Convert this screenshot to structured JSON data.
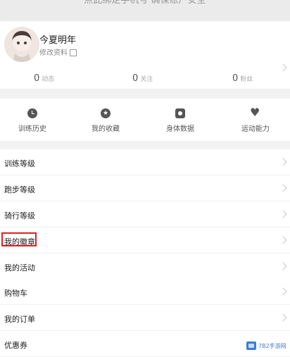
{
  "top_banner": {
    "text": "点此绑定手机号   确保账户安全"
  },
  "profile": {
    "name": "今夏明年",
    "edit_label": "修改资料",
    "stats": [
      {
        "value": "0",
        "label": "动态"
      },
      {
        "value": "0",
        "label": "关注"
      },
      {
        "value": "0",
        "label": "粉丝"
      }
    ]
  },
  "quick_actions": [
    {
      "label": "训练历史",
      "icon": "clock-icon"
    },
    {
      "label": "我的收藏",
      "icon": "star-icon"
    },
    {
      "label": "身体数据",
      "icon": "body-data-icon"
    },
    {
      "label": "运动能力",
      "icon": "heart-rate-icon"
    }
  ],
  "menu_section1": [
    {
      "label": "训练等级"
    },
    {
      "label": "跑步等级"
    },
    {
      "label": "骑行等级"
    },
    {
      "label": "我的徽章"
    },
    {
      "label": "我的活动"
    }
  ],
  "menu_section2": [
    {
      "label": "购物车"
    },
    {
      "label": "我的订单"
    },
    {
      "label": "优惠券"
    }
  ],
  "watermark": {
    "text": "7B2手游网"
  },
  "colors": {
    "highlight": "#e02020",
    "accent": "#3d7bd3"
  }
}
